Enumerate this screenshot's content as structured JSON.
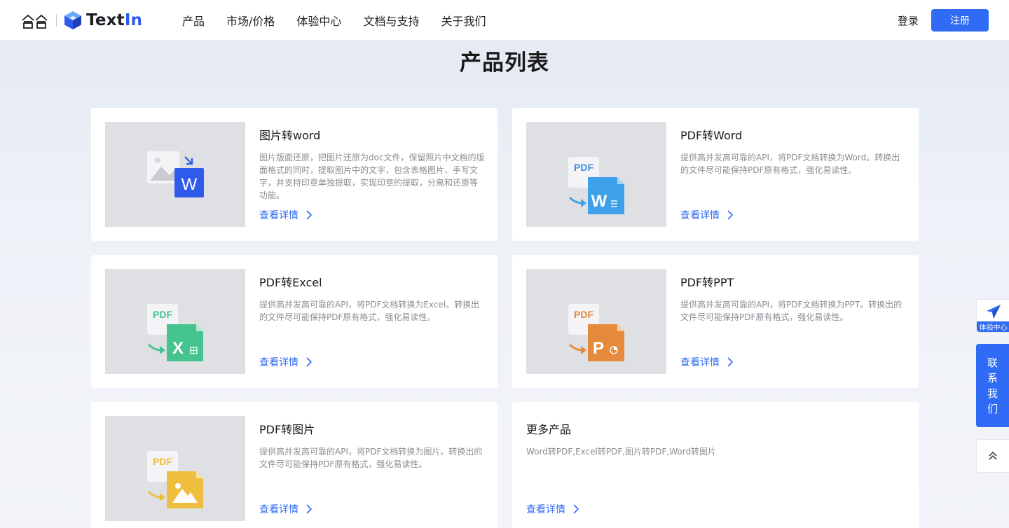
{
  "header": {
    "brand_name": "TextIn",
    "brand_name_main": "Text",
    "brand_name_accent": "In",
    "nav": [
      {
        "label": "产品"
      },
      {
        "label": "市场/价格"
      },
      {
        "label": "体验中心"
      },
      {
        "label": "文档与支持"
      },
      {
        "label": "关于我们"
      }
    ],
    "login_label": "登录",
    "register_label": "注册"
  },
  "page": {
    "title": "产品列表"
  },
  "products": [
    {
      "title": "图片转word",
      "description": "图片版面还原，把图片还原为doc文件，保留照片中文档的版面格式的同时，提取图片中的文字，包含表格图片、手写文字，并支持印章单独提取，实现印章的提取，分离和还原等功能。",
      "link": "查看详情",
      "icon": "image-to-word-icon",
      "icon_badge": "W"
    },
    {
      "title": "PDF转Word",
      "description": "提供高并发高可靠的API，将PDF文档转换为Word。转换出的文件尽可能保持PDF原有格式，强化易读性。",
      "link": "查看详情",
      "icon": "pdf-to-word-icon",
      "icon_pdf": "PDF",
      "icon_badge": "W"
    },
    {
      "title": "PDF转Excel",
      "description": "提供高并发高可靠的API，将PDF文档转换为Excel。转换出的文件尽可能保持PDF原有格式，强化易读性。",
      "link": "查看详情",
      "icon": "pdf-to-excel-icon",
      "icon_pdf": "PDF",
      "icon_badge": "X"
    },
    {
      "title": "PDF转PPT",
      "description": "提供高并发高可靠的API，将PDF文档转换为PPT。转换出的文件尽可能保持PDF原有格式，强化易读性。",
      "link": "查看详情",
      "icon": "pdf-to-ppt-icon",
      "icon_pdf": "PDF",
      "icon_badge": "P"
    },
    {
      "title": "PDF转图片",
      "description": "提供高并发高可靠的API，将PDF文档转换为图片。转换出的文件尽可能保持PDF原有格式，强化易读性。",
      "link": "查看详情",
      "icon": "pdf-to-image-icon",
      "icon_pdf": "PDF"
    },
    {
      "title": "更多产品",
      "description": "Word转PDF,Excel转PDF,图片转PDF,Word转图片",
      "link": "查看详情"
    }
  ],
  "side": {
    "experience_label": "体验中心",
    "contact_chars": [
      "联",
      "系",
      "我",
      "们"
    ],
    "back_to_top_icon": "double-chevron-up-icon"
  },
  "colors": {
    "accent": "#2f6bf5",
    "word_blue": "#3b8de6",
    "excel_green": "#45c48f",
    "ppt_orange": "#e58a3c",
    "image_yellow": "#f0be3e"
  }
}
